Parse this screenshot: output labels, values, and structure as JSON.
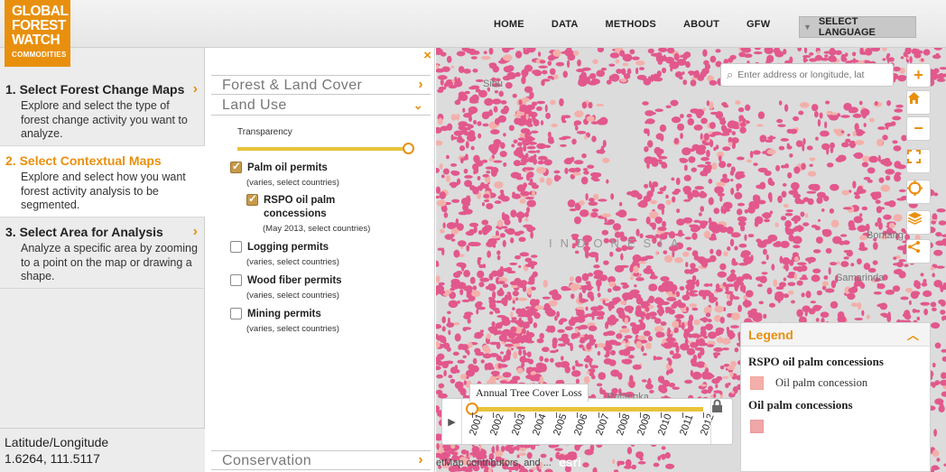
{
  "header": {
    "logo": {
      "line1": "GLOBAL",
      "line2": "FOREST",
      "line3": "WATCH",
      "line4": "COMMODITIES"
    },
    "nav": [
      "HOME",
      "DATA",
      "METHODS",
      "ABOUT",
      "GFW"
    ],
    "language": "SELECT LANGUAGE"
  },
  "steps": [
    {
      "title": "1. Select Forest Change Maps",
      "desc": "Explore and select the type of forest change activity you want to analyze.",
      "active": false
    },
    {
      "title": "2. Select Contextual Maps",
      "desc": "Explore and select how you want forest activity analysis to be segmented.",
      "active": true
    },
    {
      "title": "3. Select Area for Analysis",
      "desc": "Analyze a specific area by zooming to a point on the map or drawing a shape.",
      "active": false
    }
  ],
  "latlon": {
    "label": "Latitude/Longitude",
    "value": "1.6264, 111.5117"
  },
  "layers_panel": {
    "close": "×",
    "categories": {
      "forest": "Forest & Land Cover",
      "landuse": "Land Use",
      "conservation": "Conservation"
    },
    "transparency_label": "Transparency",
    "transparency_value": 1.0,
    "items": [
      {
        "name": "Palm oil permits",
        "sub": "(varies, select countries)",
        "checked": true
      },
      {
        "name": "RSPO oil palm concessions",
        "sub": "(May 2013, select countries)",
        "checked": true
      },
      {
        "name": "Logging permits",
        "sub": "(varies, select countries)",
        "checked": false
      },
      {
        "name": "Wood fiber permits",
        "sub": "(varies, select countries)",
        "checked": false
      },
      {
        "name": "Mining permits",
        "sub": "(varies, select countries)",
        "checked": false
      }
    ]
  },
  "map": {
    "search_placeholder": "Enter address or longitude, lat",
    "labels": {
      "sibu": "Sibu",
      "country": "INDONESIA",
      "bontang": "Bontang",
      "samarinda": "Samarinda",
      "palangka": "Palangka"
    },
    "controls": [
      "zoom-in",
      "home",
      "zoom-out",
      "fullscreen",
      "locate",
      "layers",
      "share"
    ],
    "legend": {
      "header": "Legend",
      "rspo_title": "RSPO oil palm concessions",
      "rspo_item": "Oil palm concession",
      "oil_title": "Oil palm concessions"
    },
    "timeline": {
      "title": "Annual Tree Cover Loss",
      "years": [
        "2001",
        "2002",
        "2003",
        "2004",
        "2005",
        "2006",
        "2007",
        "2008",
        "2009",
        "2010",
        "2011",
        "2012"
      ]
    },
    "attribution": "etMap contributors, and ...",
    "esri": "esri",
    "colors": {
      "loss": "#e2588c",
      "concession": "#f3b0aa",
      "accent": "#e8900e"
    }
  }
}
